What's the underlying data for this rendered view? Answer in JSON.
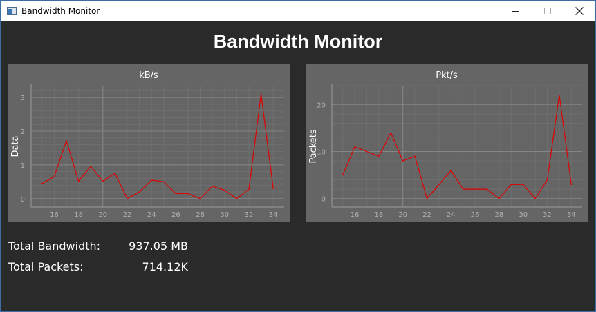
{
  "window": {
    "title": "Bandwidth Monitor",
    "controls": {
      "minimize": "–",
      "maximize": "□",
      "close": "✕"
    }
  },
  "header": {
    "title": "Bandwidth Monitor"
  },
  "stats": {
    "bandwidth_label": "Total Bandwidth:",
    "bandwidth_value": "937.05 MB",
    "packets_label": "Total Packets:",
    "packets_value": "714.12K"
  },
  "colors": {
    "background": "#2a2a2a",
    "chart_panel": "#656565",
    "series_line": "#e00000",
    "axis_text": "#b0b0b0"
  },
  "chart_data": [
    {
      "type": "line",
      "title": "kB/s",
      "xlabel": "",
      "ylabel": "Data",
      "x_ticks": [
        16,
        18,
        20,
        22,
        24,
        26,
        28,
        30,
        32,
        34
      ],
      "y_ticks": [
        0,
        1,
        2,
        3
      ],
      "xlim": [
        14.1,
        34.9
      ],
      "ylim": [
        -0.25,
        3.35
      ],
      "grid": true,
      "series": [
        {
          "x": [
            15,
            16,
            17,
            18,
            19,
            20,
            21,
            22,
            23,
            24,
            25,
            26,
            27,
            28,
            29,
            30,
            31,
            32,
            33,
            34
          ],
          "values": [
            0.45,
            0.65,
            1.72,
            0.52,
            0.95,
            0.52,
            0.75,
            0.0,
            0.2,
            0.55,
            0.5,
            0.15,
            0.15,
            0.0,
            0.37,
            0.25,
            0.0,
            0.28,
            3.1,
            0.3
          ]
        }
      ]
    },
    {
      "type": "line",
      "title": "Pkt/s",
      "xlabel": "",
      "ylabel": "Packets",
      "x_ticks": [
        16,
        18,
        20,
        22,
        24,
        26,
        28,
        30,
        32,
        34
      ],
      "y_ticks": [
        0,
        10,
        20
      ],
      "xlim": [
        14.1,
        34.9
      ],
      "ylim": [
        -1.8,
        24.0
      ],
      "grid": true,
      "series": [
        {
          "x": [
            15,
            16,
            17,
            18,
            19,
            20,
            21,
            22,
            23,
            24,
            25,
            26,
            27,
            28,
            29,
            30,
            31,
            32,
            33,
            34
          ],
          "values": [
            5,
            11,
            10,
            9,
            14,
            8,
            9,
            0,
            3,
            6,
            2,
            2,
            2,
            0,
            3,
            3,
            0,
            4,
            22,
            3
          ]
        }
      ]
    }
  ]
}
